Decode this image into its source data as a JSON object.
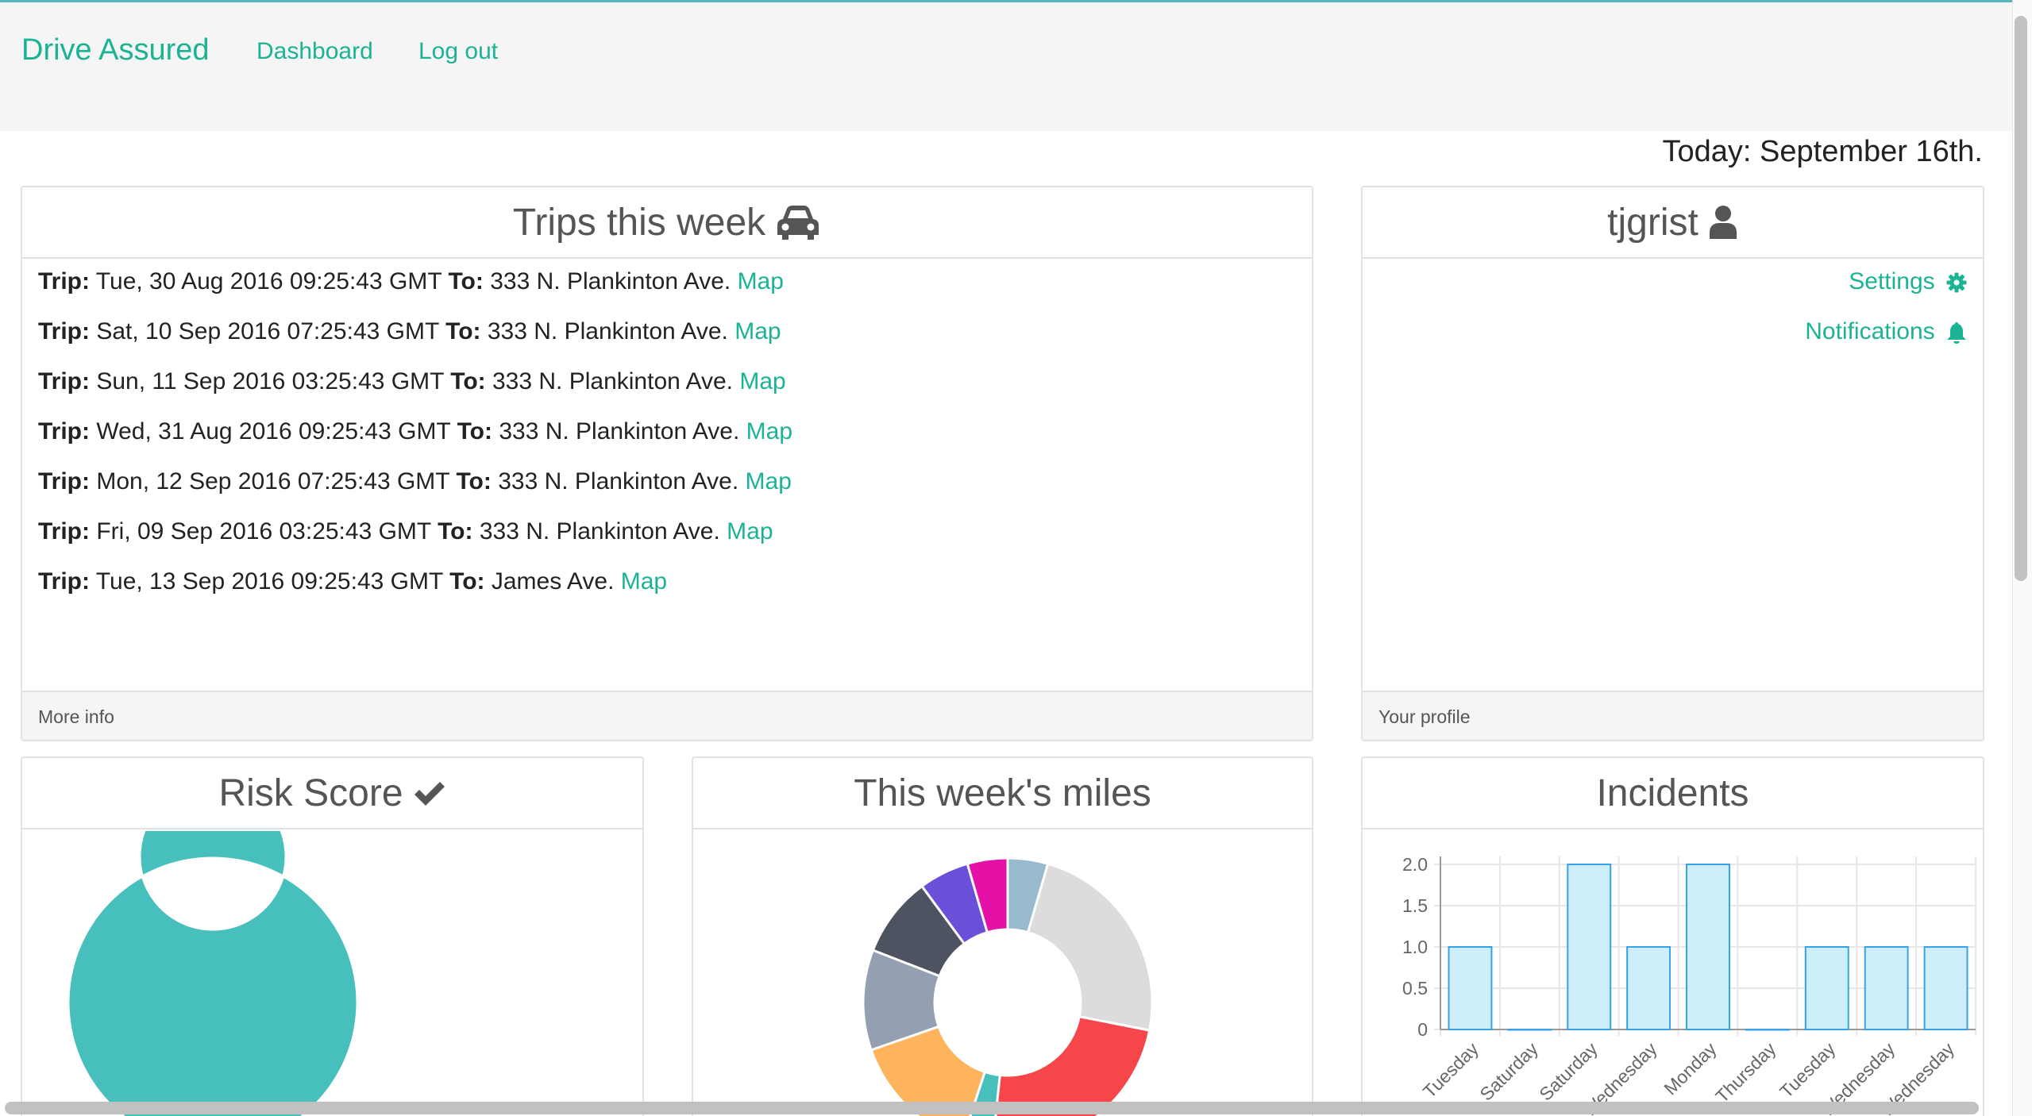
{
  "nav": {
    "brand": "Drive Assured",
    "links": [
      "Dashboard",
      "Log out"
    ]
  },
  "today": "Today: September 16th.",
  "trips_panel": {
    "title": "Trips this week",
    "icon": "car-icon",
    "trip_label": "Trip:",
    "to_label": "To:",
    "map_label": "Map",
    "trips": [
      {
        "date": "Tue, 30 Aug 2016 09:25:43 GMT",
        "dest": "333 N. Plankinton Ave."
      },
      {
        "date": "Sat, 10 Sep 2016 07:25:43 GMT",
        "dest": "333 N. Plankinton Ave."
      },
      {
        "date": "Sun, 11 Sep 2016 03:25:43 GMT",
        "dest": "333 N. Plankinton Ave."
      },
      {
        "date": "Wed, 31 Aug 2016 09:25:43 GMT",
        "dest": "333 N. Plankinton Ave."
      },
      {
        "date": "Mon, 12 Sep 2016 07:25:43 GMT",
        "dest": "333 N. Plankinton Ave."
      },
      {
        "date": "Fri, 09 Sep 2016 03:25:43 GMT",
        "dest": "333 N. Plankinton Ave."
      },
      {
        "date": "Tue, 13 Sep 2016 09:25:43 GMT",
        "dest": "James Ave."
      }
    ],
    "footer": "More info"
  },
  "profile_panel": {
    "username": "tjgrist",
    "icon": "user-icon",
    "settings": "Settings",
    "notifications": "Notifications",
    "footer": "Your profile"
  },
  "risk_panel": {
    "title": "Risk Score",
    "icon": "check-icon"
  },
  "miles_panel": {
    "title": "This week's miles"
  },
  "incidents_panel": {
    "title": "Incidents"
  },
  "colors": {
    "accent": "#1bb394",
    "teal": "#46bfbd"
  },
  "chart_data": [
    {
      "type": "pie",
      "variant": "doughnut",
      "panel": "Risk Score",
      "values": [
        100
      ],
      "colors": [
        "#46bfbd"
      ]
    },
    {
      "type": "pie",
      "variant": "doughnut",
      "panel": "This week's miles",
      "values": [
        4,
        21,
        21,
        3,
        13,
        10,
        8,
        5,
        4
      ],
      "colors": [
        "#97bbcd",
        "#dcdcdc",
        "#f7464a",
        "#46bfbd",
        "#fdb45c",
        "#949fb1",
        "#4d5360",
        "#6b4fd8",
        "#e511a6"
      ]
    },
    {
      "type": "bar",
      "panel": "Incidents",
      "categories": [
        "Tuesday",
        "Saturday",
        "Saturday",
        "Wednesday",
        "Monday",
        "Thursday",
        "Tuesday",
        "Wednesday",
        "Wednesday"
      ],
      "values": [
        1,
        0,
        2,
        1,
        2,
        0,
        1,
        1,
        1
      ],
      "ylim": [
        0,
        2
      ],
      "yticks": [
        "0",
        "0.5",
        "1.0",
        "1.5",
        "2.0"
      ],
      "grid": true,
      "bar_fill": "#cdeefa",
      "bar_stroke": "#36a2eb"
    }
  ]
}
